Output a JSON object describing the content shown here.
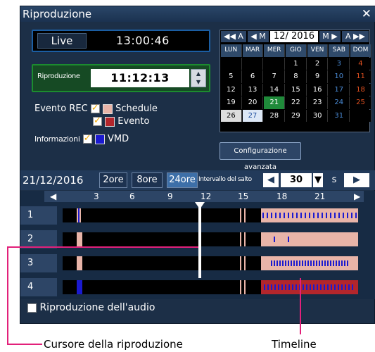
{
  "window": {
    "title": "Riproduzione",
    "close": "✕"
  },
  "live": {
    "button": "Live",
    "time": "13:00:46"
  },
  "playback": {
    "label": "Riproduzione",
    "time": "11:12:13",
    "up": "▲",
    "down": "▼"
  },
  "events": {
    "label_rec": "Evento REC",
    "schedule": "Schedule",
    "evento": "Evento",
    "label_info": "Informazioni",
    "vmd": "VMD",
    "colors": {
      "schedule": "#e8b4a8",
      "evento": "#b3262c",
      "vmd": "#1a1ad0"
    }
  },
  "calendar": {
    "nav": [
      "◀◀ A",
      "◀ M",
      "12/ 2016",
      "M ▶",
      "A ▶▶"
    ],
    "headers": [
      "LUN",
      "MAR",
      "MER",
      "GIO",
      "VEN",
      "SAB",
      "DOM"
    ],
    "days": [
      "",
      "",
      "",
      "1",
      "2",
      "3",
      "4",
      "5",
      "6",
      "7",
      "8",
      "9",
      "10",
      "11",
      "12",
      "13",
      "14",
      "15",
      "16",
      "17",
      "18",
      "19",
      "20",
      "21",
      "22",
      "23",
      "24",
      "25",
      "26",
      "27",
      "28",
      "29",
      "30",
      "31",
      ""
    ],
    "colors": {
      "saturday": "#4a8bd6",
      "sunday": "#e05020",
      "selected": "#1f8a3a",
      "today": "#ffffff"
    }
  },
  "config_button": "Configurazione avanzata",
  "timebar": {
    "date": "21/12/2016",
    "ranges": [
      "2ore",
      "8ore",
      "24ore"
    ],
    "interval_label": "Intervallo del salto",
    "interval_value": "30",
    "interval_unit": "s"
  },
  "timeline": {
    "ticks": [
      "3",
      "6",
      "9",
      "12",
      "15",
      "18",
      "21"
    ],
    "rows": [
      "1",
      "2",
      "3",
      "4"
    ]
  },
  "audio_label": "Riproduzione dell'audio",
  "callouts": {
    "cursor": "Cursore della riproduzione",
    "timeline": "Timeline"
  }
}
